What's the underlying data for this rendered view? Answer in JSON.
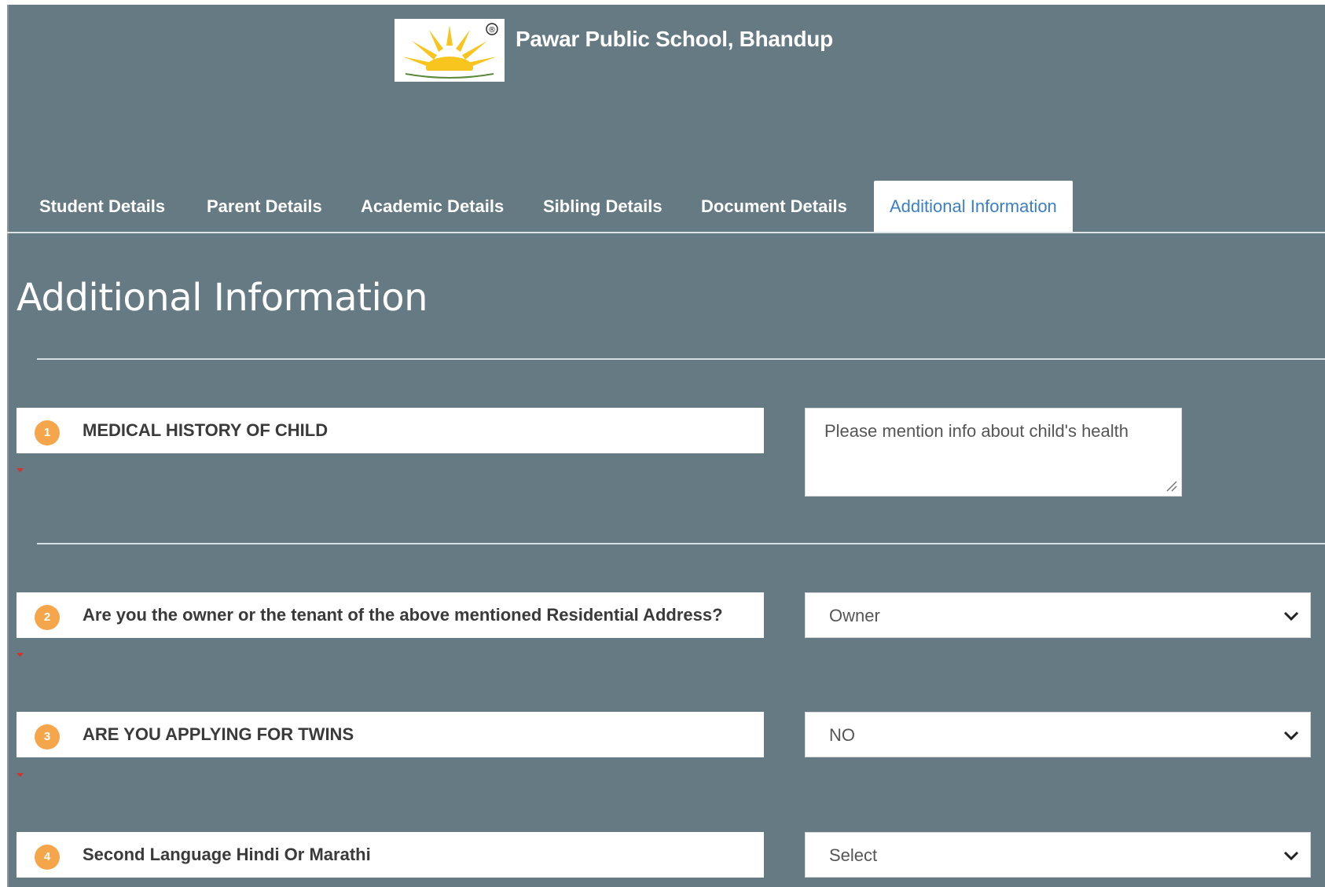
{
  "header": {
    "school_name": "Pawar Public School, Bhandup",
    "logo": "pawar-public-school-logo",
    "logo_registered_mark": "®"
  },
  "tabs": [
    {
      "label": "Student Details",
      "active": false
    },
    {
      "label": "Parent Details",
      "active": false
    },
    {
      "label": "Academic Details",
      "active": false
    },
    {
      "label": "Sibling Details",
      "active": false
    },
    {
      "label": "Document Details",
      "active": false
    },
    {
      "label": "Additional Information",
      "active": true
    }
  ],
  "page_title": "Additional Information",
  "questions": [
    {
      "number": "1",
      "label": "MEDICAL HISTORY OF CHILD",
      "input_type": "textarea",
      "placeholder": "Please mention info about child's health",
      "required": true
    },
    {
      "number": "2",
      "label": "Are you the owner or the tenant of the above mentioned Residential Address?",
      "input_type": "select",
      "value": "Owner",
      "required": true
    },
    {
      "number": "3",
      "label": "ARE YOU APPLYING FOR TWINS",
      "input_type": "select",
      "value": "NO",
      "required": true
    },
    {
      "number": "4",
      "label": "Second Language Hindi Or Marathi",
      "input_type": "select",
      "value": "Select",
      "required": false
    }
  ],
  "colors": {
    "background": "#657a83",
    "active_tab_text": "#3b7fc4",
    "number_badge": "#f5a54a",
    "required_marker": "#d0342c"
  }
}
